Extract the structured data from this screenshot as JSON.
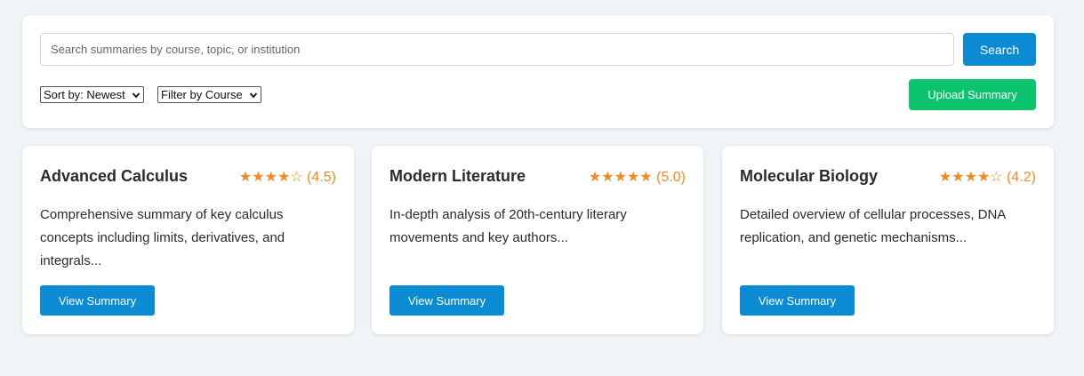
{
  "search": {
    "placeholder": "Search summaries by course, topic, or institution",
    "value": "",
    "button_label": "Search"
  },
  "sort": {
    "selected": "Sort by: Newest"
  },
  "filter": {
    "selected": "Filter by Course"
  },
  "upload": {
    "label": "Upload Summary"
  },
  "colors": {
    "primary": "#0a8bd3",
    "success": "#0dc46e",
    "rating": "#f18a23"
  },
  "cards": [
    {
      "title": "Advanced Calculus",
      "stars": "★★★★☆",
      "rating_value": 4.5,
      "rating_text": "(4.5)",
      "description": "Comprehensive summary of key calculus concepts including limits, derivatives, and integrals...",
      "button_label": "View Summary"
    },
    {
      "title": "Modern Literature",
      "stars": "★★★★★",
      "rating_value": 5.0,
      "rating_text": "(5.0)",
      "description": "In-depth analysis of 20th-century literary movements and key authors...",
      "button_label": "View Summary"
    },
    {
      "title": "Molecular Biology",
      "stars": "★★★★☆",
      "rating_value": 4.2,
      "rating_text": "(4.2)",
      "description": "Detailed overview of cellular processes, DNA replication, and genetic mechanisms...",
      "button_label": "View Summary"
    }
  ]
}
